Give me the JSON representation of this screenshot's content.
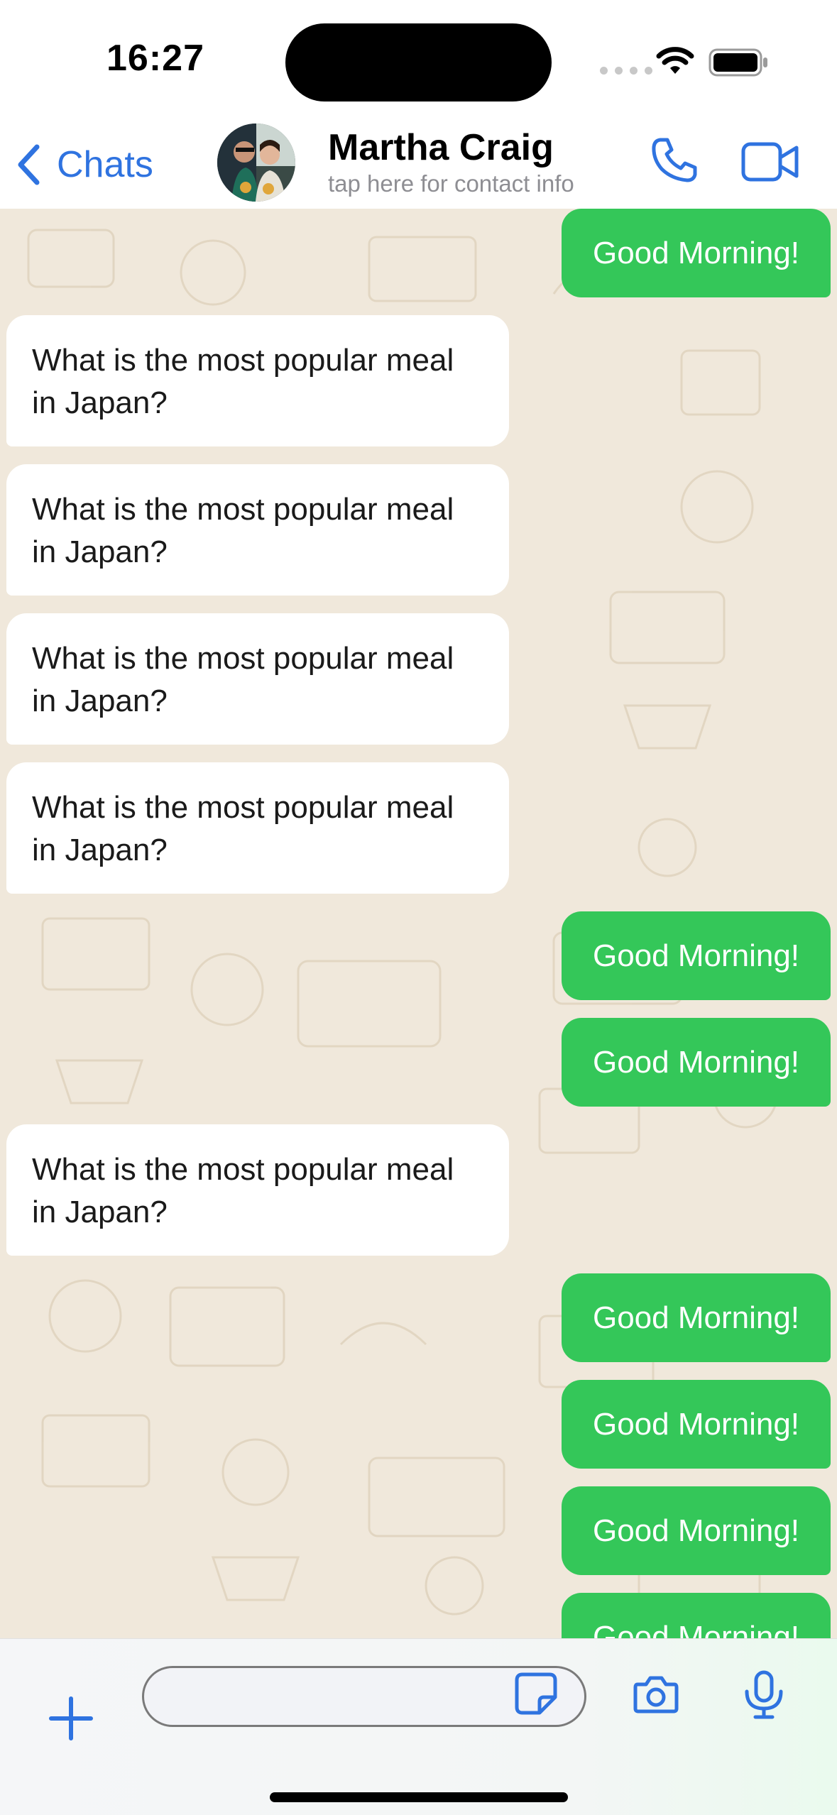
{
  "status_bar": {
    "time": "16:27",
    "wifi_icon": "wifi-icon",
    "battery_icon": "battery-icon"
  },
  "header": {
    "back_label": "Chats",
    "back_icon": "chevron-left-icon",
    "contact_name": "Martha Craig",
    "contact_subtitle": "tap here for contact info",
    "call_icon": "phone-icon",
    "video_icon": "video-camera-icon",
    "accent_color": "#2F73E0"
  },
  "chat": {
    "background_color": "#F0E8DB",
    "outgoing_color": "#34C759",
    "incoming_color": "#FFFFFF",
    "messages": [
      {
        "direction": "outgoing",
        "text": "Good Morning!"
      },
      {
        "direction": "incoming",
        "text": "What is the most popular meal in Japan?"
      },
      {
        "direction": "incoming",
        "text": "What is the most popular meal in Japan?"
      },
      {
        "direction": "incoming",
        "text": "What is the most popular meal in Japan?"
      },
      {
        "direction": "incoming",
        "text": "What is the most popular meal in Japan?"
      },
      {
        "direction": "outgoing",
        "text": "Good Morning!"
      },
      {
        "direction": "outgoing",
        "text": "Good Morning!"
      },
      {
        "direction": "incoming",
        "text": "What is the most popular meal in Japan?"
      },
      {
        "direction": "outgoing",
        "text": "Good Morning!"
      },
      {
        "direction": "outgoing",
        "text": "Good Morning!"
      },
      {
        "direction": "outgoing",
        "text": "Good Morning!"
      },
      {
        "direction": "outgoing",
        "text": "Good Morning!"
      }
    ]
  },
  "input_bar": {
    "message_value": "",
    "add_icon": "plus-icon",
    "sticker_icon": "sticker-icon",
    "camera_icon": "camera-icon",
    "mic_icon": "microphone-icon"
  }
}
